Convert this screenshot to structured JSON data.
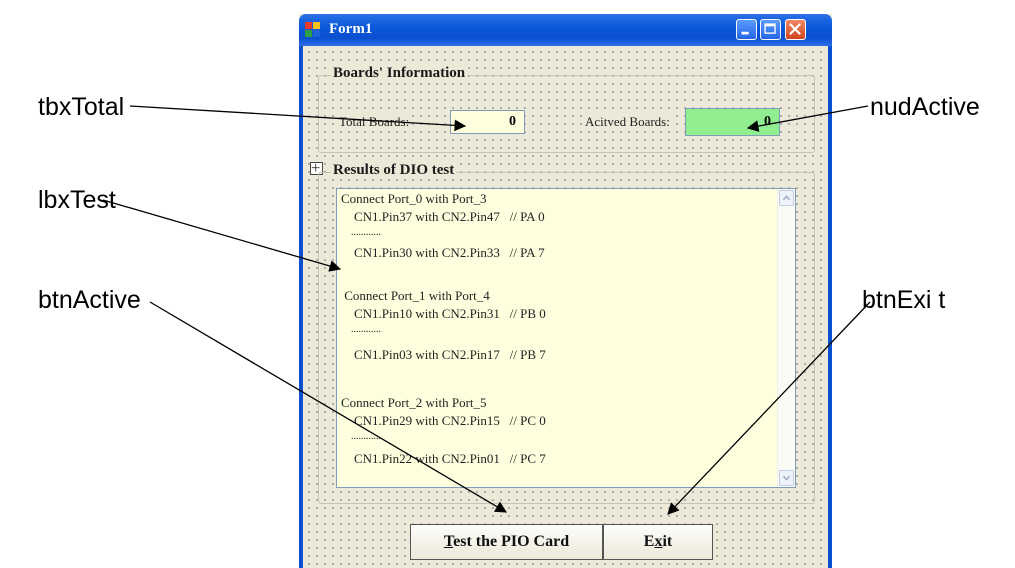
{
  "window": {
    "title": "Form1"
  },
  "boards_group": {
    "title": "Boards' Information",
    "total_label": "Total Boards:",
    "total_value": "0",
    "active_label": "Acitved Boards:",
    "active_value": "0"
  },
  "results_group": {
    "title": "Results of DIO test",
    "lines": [
      "Connect Port_0 with Port_3",
      "    CN1.Pin37 with CN2.Pin47   // PA 0",
      "    ............",
      "    CN1.Pin30 with CN2.Pin33   // PA 7",
      " Connect Port_1 with Port_4",
      "    CN1.Pin10 with CN2.Pin31   // PB 0",
      "    ............",
      "    CN1.Pin03 with CN2.Pin17   // PB 7",
      "Connect Port_2 with Port_5",
      "    CN1.Pin29 with CN2.Pin15   // PC 0",
      "    ............",
      "    CN1.Pin22 with CN2.Pin01   // PC 7"
    ]
  },
  "buttons": {
    "test_label": "Test the PIO Card",
    "exit_label": "Exit"
  },
  "callouts": {
    "tbxTotal": "tbxTotal",
    "nudActive": "nudActive",
    "lbxTest": "lbxTest",
    "btnActive": "btnActive",
    "btnExit": "btnExi t"
  },
  "colors": {
    "title_bar": "#0a4fcf",
    "textbox_bg": "#ffffe0",
    "active_bg": "#90ee90"
  },
  "icons": [
    "app-icon",
    "minimize-icon",
    "maximize-icon",
    "close-icon",
    "move-handle-icon"
  ]
}
